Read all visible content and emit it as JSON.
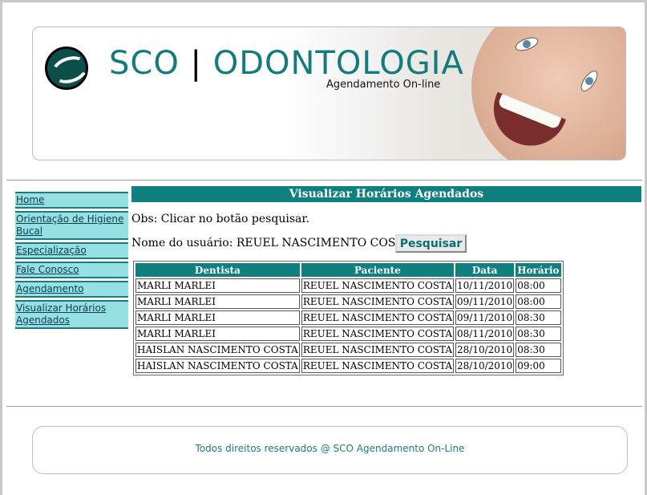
{
  "header": {
    "brand_left": "SCO",
    "brand_sep": "|",
    "brand_right": "ODONTOLOGIA",
    "tagline": "Agendamento On-line"
  },
  "sidebar": {
    "items": [
      {
        "label": "Home"
      },
      {
        "label": "Orientação de Higiene Bucal"
      },
      {
        "label": "Especialização"
      },
      {
        "label": "Fale Conosco"
      },
      {
        "label": "Agendamento"
      },
      {
        "label": "Visualizar Horários Agendados"
      }
    ]
  },
  "main": {
    "title": "Visualizar Horários Agendados",
    "obs": "Obs: Clicar no botão pesquisar.",
    "user_label": "Nome do usuário: REUEL NASCIMENTO COSTA",
    "search_button": "Pesquisar",
    "table": {
      "headers": [
        "Dentista",
        "Paciente",
        "Data",
        "Horário"
      ],
      "rows": [
        [
          "MARLI MARLEI",
          "REUEL NASCIMENTO COSTA",
          "10/11/2010",
          "08:00"
        ],
        [
          "MARLI MARLEI",
          "REUEL NASCIMENTO COSTA",
          "09/11/2010",
          "08:00"
        ],
        [
          "MARLI MARLEI",
          "REUEL NASCIMENTO COSTA",
          "09/11/2010",
          "08:30"
        ],
        [
          "MARLI MARLEI",
          "REUEL NASCIMENTO COSTA",
          "08/11/2010",
          "08:30"
        ],
        [
          "HAISLAN NASCIMENTO COSTA",
          "REUEL NASCIMENTO COSTA",
          "28/10/2010",
          "08:30"
        ],
        [
          "HAISLAN NASCIMENTO COSTA",
          "REUEL NASCIMENTO COSTA",
          "28/10/2010",
          "09:00"
        ]
      ]
    }
  },
  "footer": {
    "text": "Todos direitos reservados @ SCO Agendamento On-Line"
  },
  "colors": {
    "brand_teal": "#127b7b",
    "header_teal": "#0f7f7f",
    "nav_background": "#95e0e0"
  }
}
